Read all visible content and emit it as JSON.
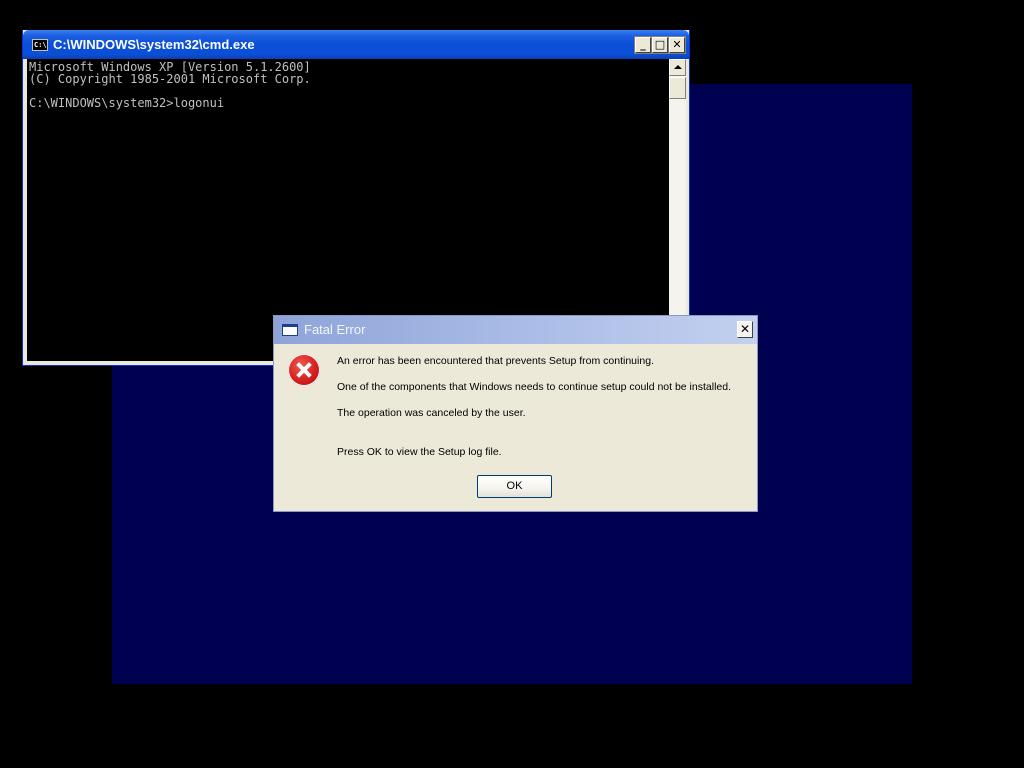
{
  "cmd_window": {
    "title": "C:\\WINDOWS\\system32\\cmd.exe",
    "icon_label": "C:\\",
    "minimize_glyph": "_",
    "maximize_glyph": "□",
    "close_glyph": "✕",
    "console_lines": [
      "Microsoft Windows XP [Version 5.1.2600]",
      "(C) Copyright 1985-2001 Microsoft Corp.",
      "",
      "C:\\WINDOWS\\system32>logonui"
    ]
  },
  "dialog": {
    "title": "Fatal Error",
    "close_glyph": "✕",
    "icon": "error-icon",
    "messages": [
      "An error has been encountered that prevents Setup from continuing.",
      "One of the components that Windows needs to continue setup could not be installed.",
      "The operation was canceled by the user.",
      "Press OK to view the Setup log file."
    ],
    "ok_label": "OK"
  },
  "colors": {
    "desktop": "#000000",
    "setup_backdrop": "#000050",
    "console_bg": "#000000",
    "console_text": "#c0c0c0",
    "dialog_face": "#ece9d8",
    "error_red": "#d51f1f"
  }
}
